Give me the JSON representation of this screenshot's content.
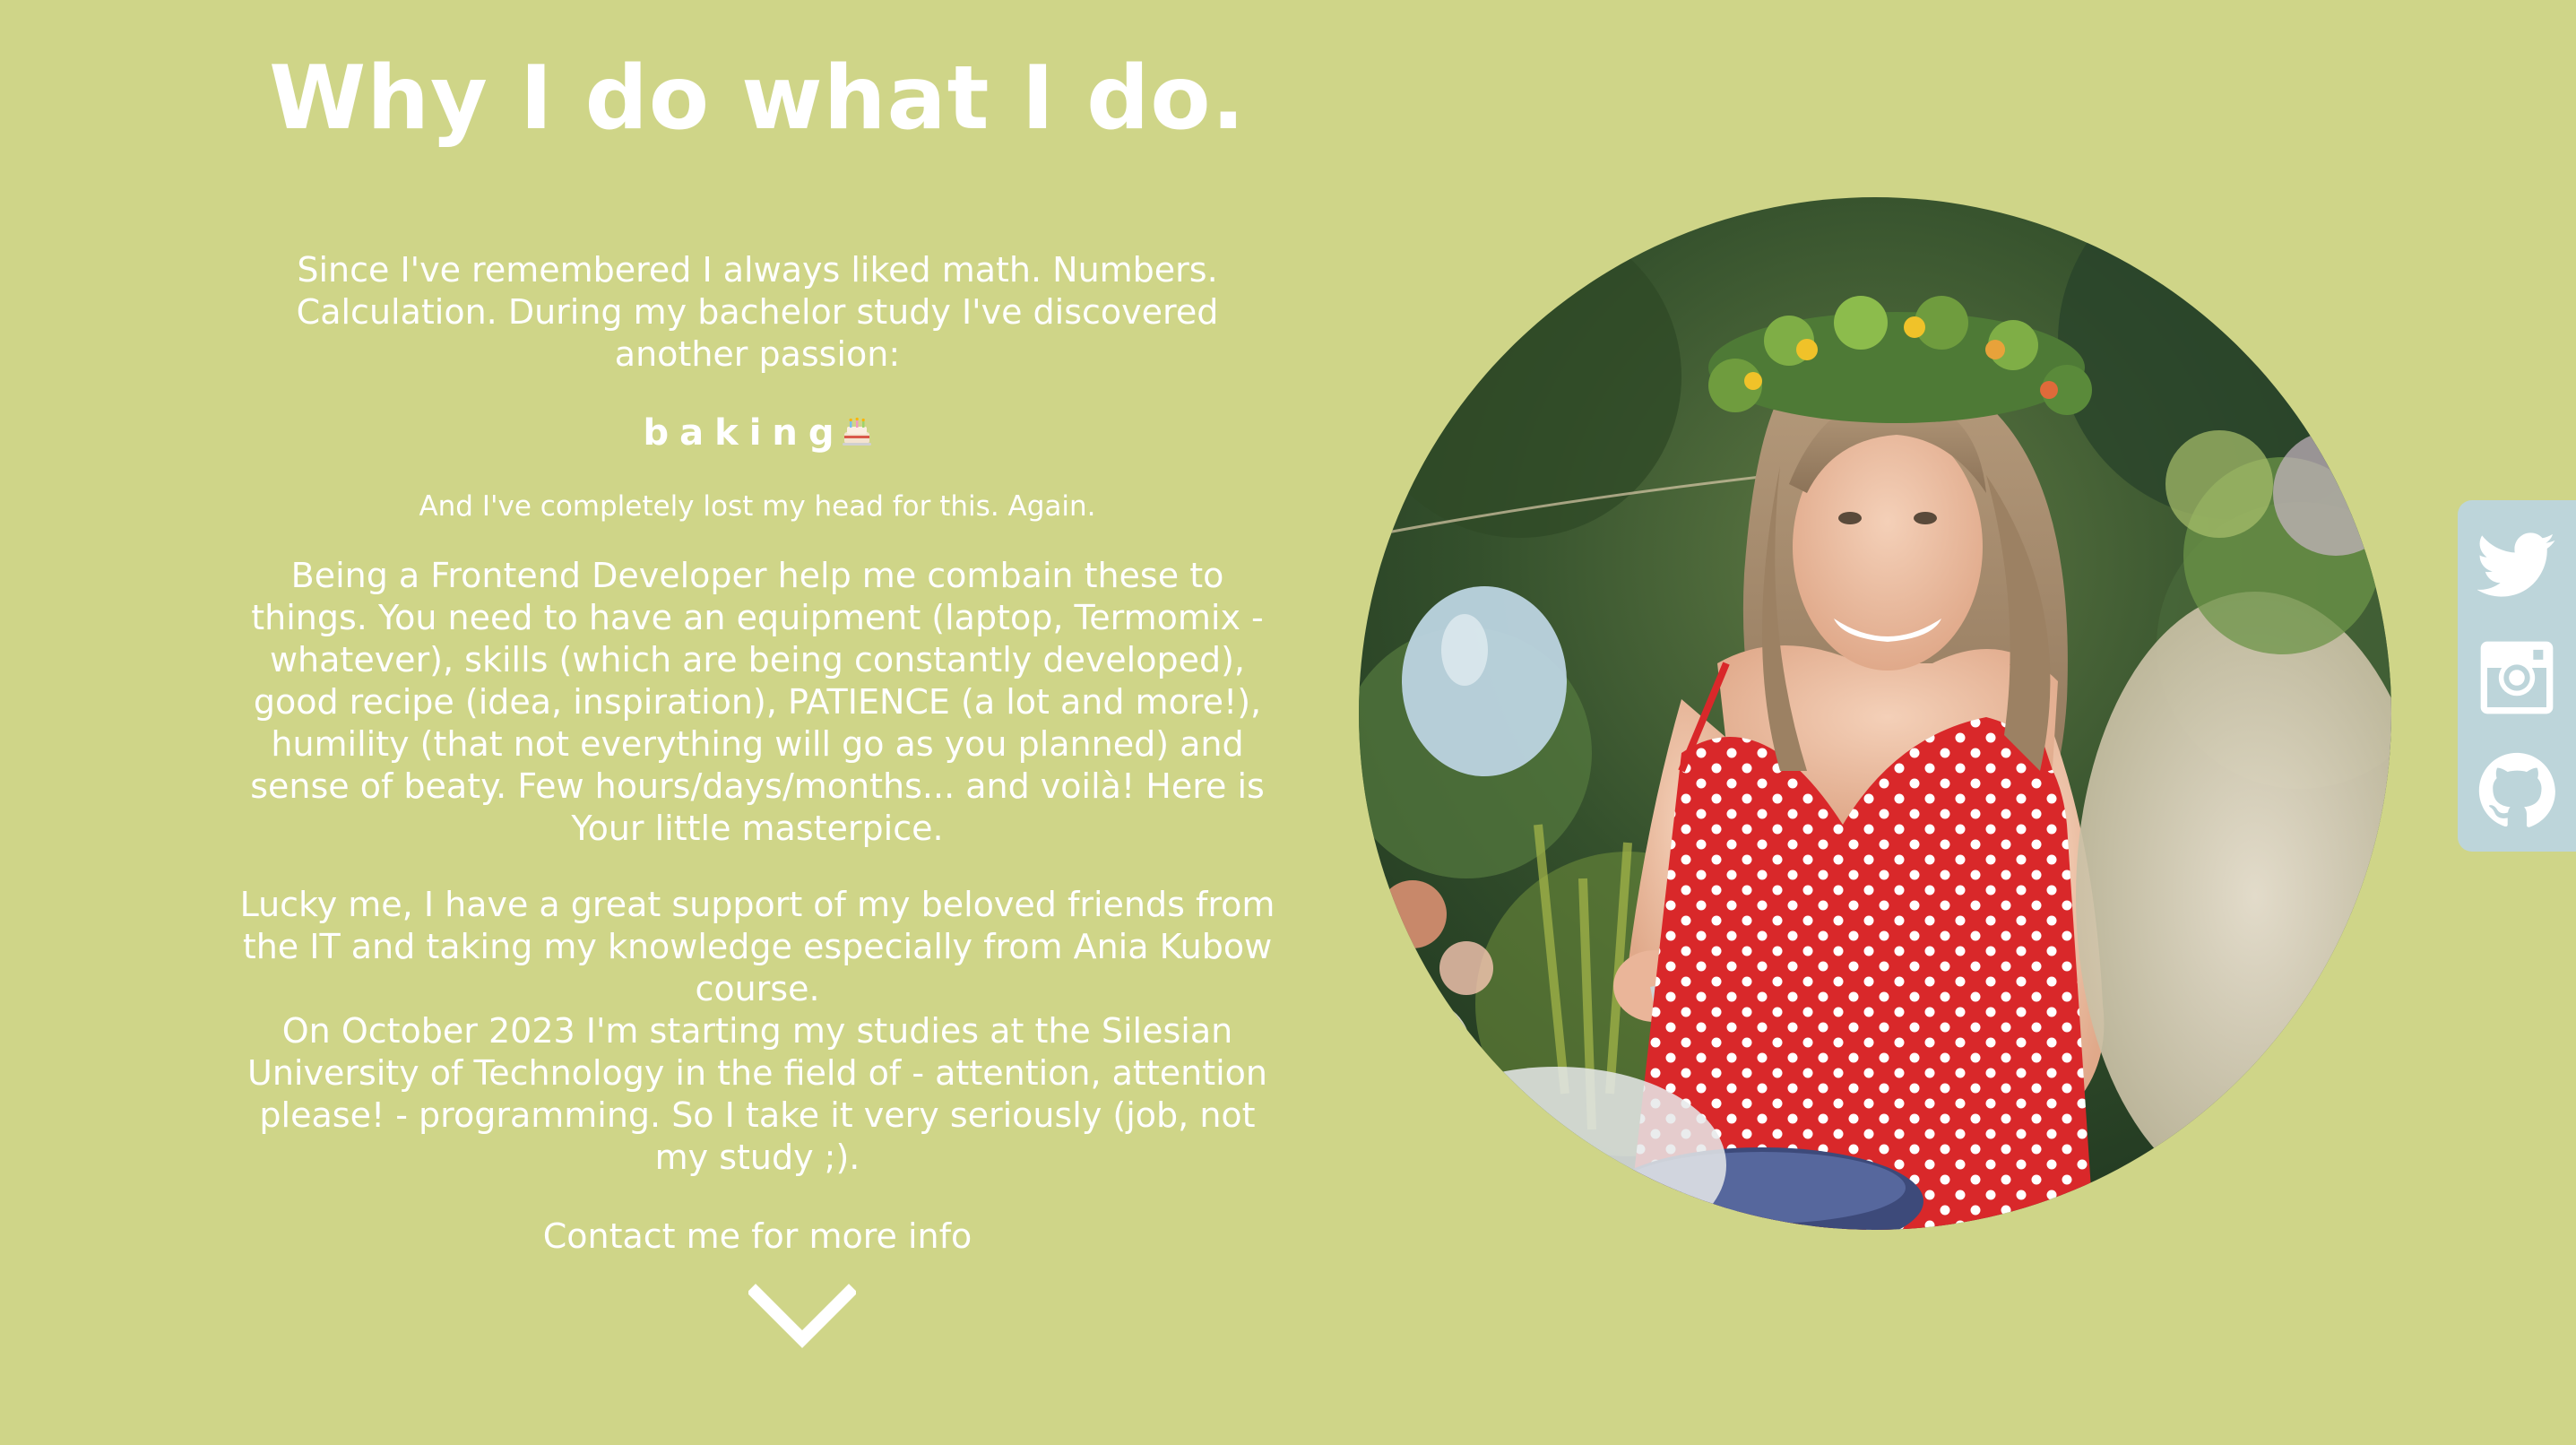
{
  "colors": {
    "background": "#cfd588",
    "text": "#ffffff",
    "social_bar": "#bdd5da",
    "dress_red": "#d9282a",
    "foliage_green": "#3f5b30"
  },
  "about": {
    "title": "Why I do what I do.",
    "paragraph_intro": "Since I've remembered I always liked math. Numbers. Calculation. During my bachelor study I've discovered another passion:",
    "passion_word": "baking",
    "passion_icon": "birthday-cake-icon",
    "aside_note": "And I've completely lost my head for this. Again.",
    "paragraph_developer": "Being a Frontend Developer help me combain these to things. You need to have an equipment (laptop, Termomix - whatever), skills (which are being constantly developed), good recipe (idea, inspiration), PATIENCE (a lot and more!), humility (that not everything will go as you planned) and sense of beaty. Few hours/days/months... and voilà! Here is Your little masterpice.",
    "paragraph_support": "Lucky me, I have a great support of my beloved friends from the IT and taking my knowledge especially from Ania Kubow course.",
    "paragraph_studies": "On October 2023 I'm starting my studies at the Silesian University of Technology in the field of - attention, attention please! - programming. So I take it very seriously (job, not my study ;).",
    "contact_link": "Contact me for more info",
    "scroll_icon": "chevron-down-icon"
  },
  "photo": {
    "subject": "portrait-photo"
  },
  "social": {
    "items": [
      {
        "icon": "twitter-icon"
      },
      {
        "icon": "instagram-icon"
      },
      {
        "icon": "github-icon"
      }
    ]
  }
}
